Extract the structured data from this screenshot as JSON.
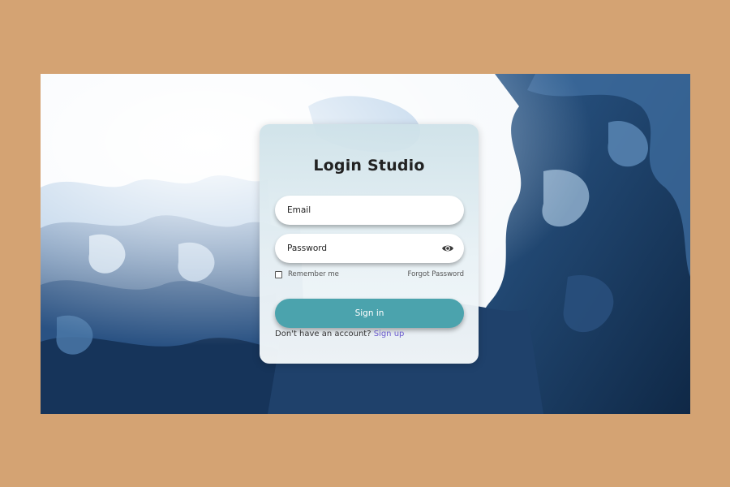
{
  "colors": {
    "page_bg": "#d4a373",
    "accent_button": "#4ba3ad",
    "link": "#6a5acd",
    "wave_dark": "#1e3f66",
    "wave_mid": "#3a6a99",
    "wave_light": "#a9c6e3"
  },
  "login": {
    "title": "Login Studio",
    "email_placeholder": "Email",
    "password_placeholder": "Password",
    "password_toggle_icon": "eye-icon",
    "remember_label": "Remember me",
    "remember_checked": false,
    "forgot_label": "Forgot Password",
    "signin_label": "Sign in",
    "no_account_text": "Don't have an account?",
    "signup_label": "Sign up"
  }
}
